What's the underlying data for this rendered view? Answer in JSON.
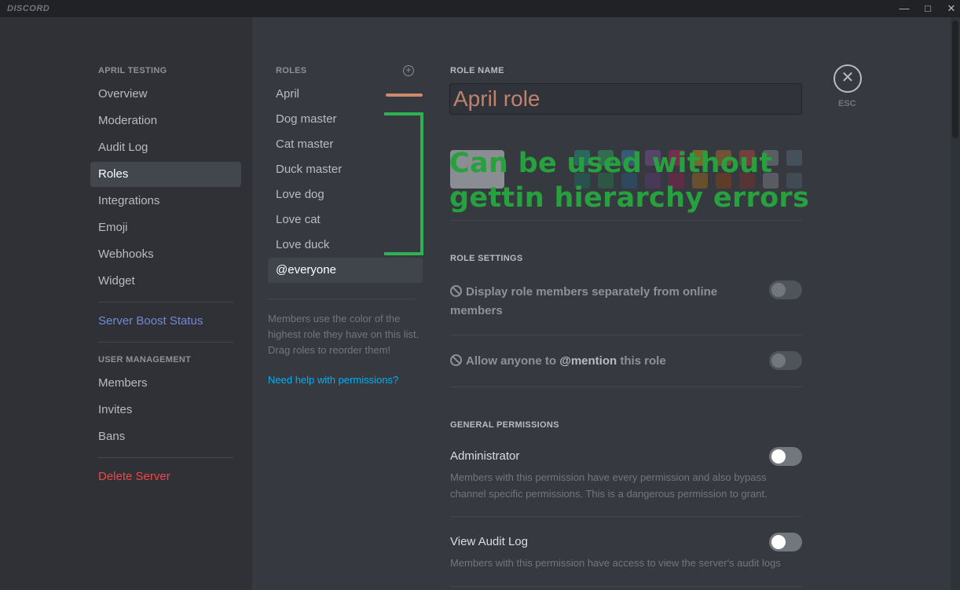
{
  "app": {
    "brand": "DISCORD"
  },
  "sidebar": {
    "server_header": "APRIL TESTING",
    "items": [
      "Overview",
      "Moderation",
      "Audit Log",
      "Roles",
      "Integrations",
      "Emoji",
      "Webhooks",
      "Widget"
    ],
    "active_item": "Roles",
    "boost": "Server Boost Status",
    "user_header": "USER MANAGEMENT",
    "user_items": [
      "Members",
      "Invites",
      "Bans"
    ],
    "delete": "Delete Server"
  },
  "roles": {
    "header": "ROLES",
    "items": [
      "April",
      "Dog master",
      "Cat master",
      "Duck master",
      "Love dog",
      "Love cat",
      "Love duck",
      "@everyone"
    ],
    "selected": "@everyone",
    "help_text": "Members use the color of the highest role they have on this list. Drag roles to reorder them!",
    "help_link": "Need help with permissions?"
  },
  "annotation": {
    "line1": "Can be used without",
    "line2": "gettin hierarchy errors",
    "color": "#26a13e"
  },
  "role_edit": {
    "name_label": "ROLE NAME",
    "name_value": "April role",
    "name_color": "#c0826a",
    "settings_label": "ROLE SETTINGS",
    "settings": [
      {
        "label": "Display role members separately from online members",
        "enabled": false
      },
      {
        "pre": "Allow anyone to ",
        "mention": "@mention",
        "post": " this role",
        "enabled": false
      }
    ],
    "general_label": "GENERAL PERMISSIONS",
    "permissions": [
      {
        "title": "Administrator",
        "desc": "Members with this permission have every permission and also bypass channel specific permissions. This is a dangerous permission to grant.",
        "on": false
      },
      {
        "title": "View Audit Log",
        "desc": "Members with this permission have access to view the server's audit logs",
        "on": false
      }
    ],
    "swatch_colors_top": [
      "#1abc9c",
      "#2ecc71",
      "#3498db",
      "#9b59b6",
      "#e91e63",
      "#f1c40f",
      "#e67e22",
      "#e74c3c",
      "#95a5a6",
      "#607d8b"
    ],
    "swatch_colors_bottom": [
      "#11806a",
      "#1f8b4c",
      "#206694",
      "#71368a",
      "#ad1457",
      "#c27c0e",
      "#a84300",
      "#992d22",
      "#979c9f",
      "#546e7a"
    ]
  },
  "close": {
    "label": "ESC"
  }
}
